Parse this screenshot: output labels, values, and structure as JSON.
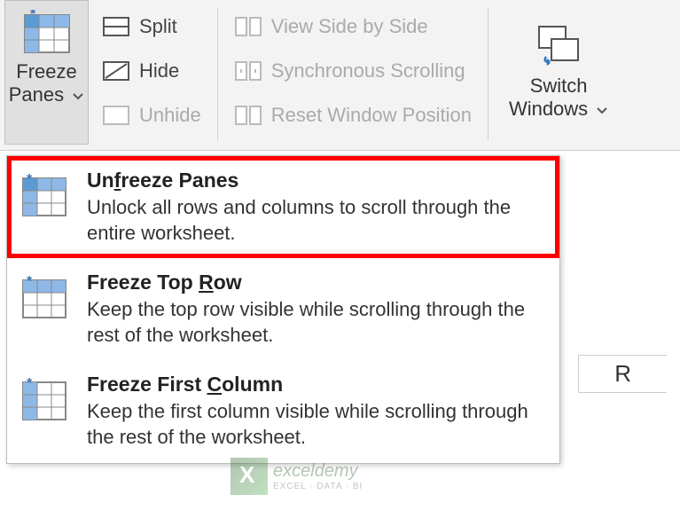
{
  "ribbon": {
    "freeze_panes": {
      "line1": "Freeze",
      "line2": "Panes"
    },
    "split": "Split",
    "hide": "Hide",
    "unhide": "Unhide",
    "view_side_by_side": "View Side by Side",
    "synchronous_scrolling": "Synchronous Scrolling",
    "reset_window_position": "Reset Window Position",
    "switch_windows": {
      "line1": "Switch",
      "line2": "Windows"
    }
  },
  "dropdown": {
    "items": [
      {
        "title_pre": "Un",
        "title_u": "f",
        "title_post": "reeze Panes",
        "desc": "Unlock all rows and columns to scroll through the entire worksheet."
      },
      {
        "title_pre": "Freeze Top ",
        "title_u": "R",
        "title_post": "ow",
        "desc": "Keep the top row visible while scrolling through the rest of the worksheet."
      },
      {
        "title_pre": "Freeze First ",
        "title_u": "C",
        "title_post": "olumn",
        "desc": "Keep the first column visible while scrolling through the rest of the worksheet."
      }
    ]
  },
  "column_header": "R",
  "watermark": {
    "title": "exceldemy",
    "subtitle": "EXCEL · DATA · BI"
  }
}
